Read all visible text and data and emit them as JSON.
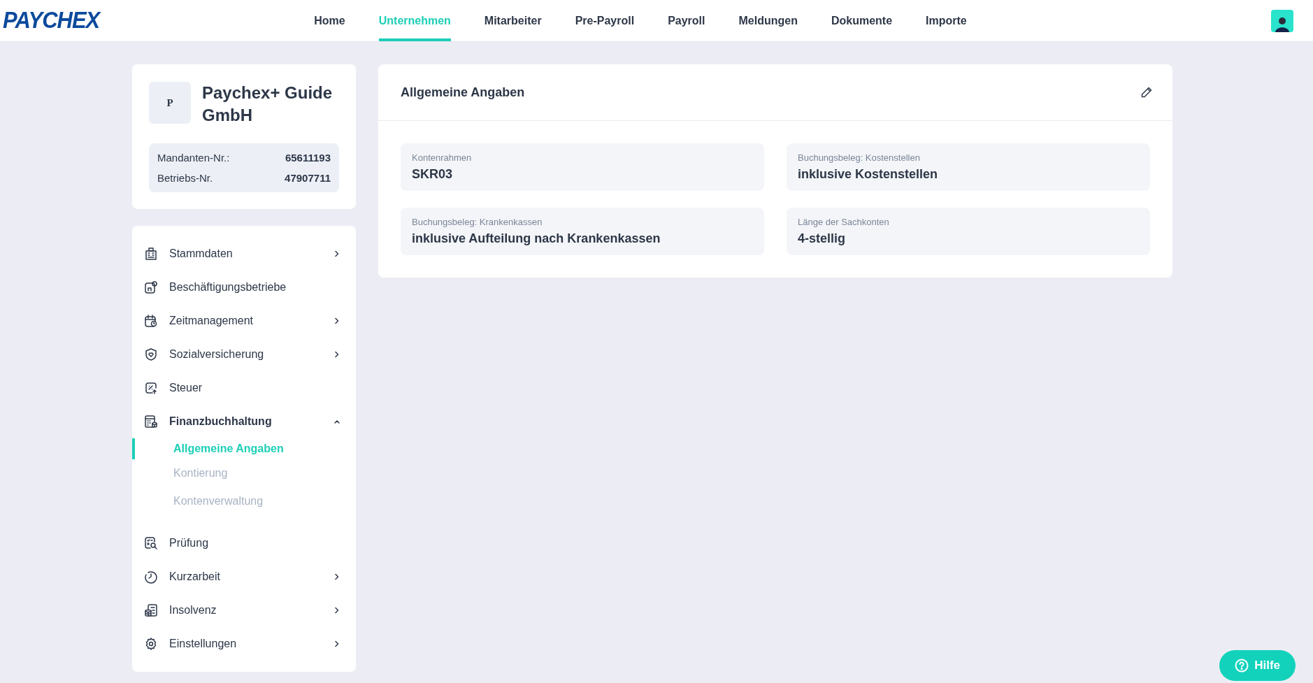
{
  "logo": "PAYCHEX",
  "nav": [
    {
      "label": "Home",
      "selected": false
    },
    {
      "label": "Unternehmen",
      "selected": true
    },
    {
      "label": "Mitarbeiter",
      "selected": false
    },
    {
      "label": "Pre-Payroll",
      "selected": false
    },
    {
      "label": "Payroll",
      "selected": false
    },
    {
      "label": "Meldungen",
      "selected": false
    },
    {
      "label": "Dokumente",
      "selected": false
    },
    {
      "label": "Importe",
      "selected": false
    }
  ],
  "company": {
    "initial": "P",
    "name": "Paychex+ Guide GmbH",
    "facts": [
      {
        "label": "Mandanten-Nr.:",
        "value": "65611193"
      },
      {
        "label": "Betriebs-Nr.",
        "value": "47907711"
      }
    ]
  },
  "menu": [
    {
      "label": "Stammdaten",
      "has_submenu": true,
      "expanded": false
    },
    {
      "label": "Beschäftigungsbetriebe",
      "has_submenu": false,
      "expanded": false
    },
    {
      "label": "Zeitmanagement",
      "has_submenu": true,
      "expanded": false
    },
    {
      "label": "Sozialversicherung",
      "has_submenu": true,
      "expanded": false
    },
    {
      "label": "Steuer",
      "has_submenu": false,
      "expanded": false
    },
    {
      "label": "Finanzbuchhaltung",
      "has_submenu": true,
      "expanded": true,
      "children": [
        {
          "label": "Allgemeine Angaben",
          "selected": true,
          "disabled": false
        },
        {
          "label": "Kontierung",
          "selected": false,
          "disabled": true
        },
        {
          "label": "Kontenverwaltung",
          "selected": false,
          "disabled": true
        }
      ]
    },
    {
      "label": "Prüfung",
      "has_submenu": false,
      "expanded": false
    },
    {
      "label": "Kurzarbeit",
      "has_submenu": true,
      "expanded": false
    },
    {
      "label": "Insolvenz",
      "has_submenu": true,
      "expanded": false
    },
    {
      "label": "Einstellungen",
      "has_submenu": true,
      "expanded": false
    }
  ],
  "panel": {
    "title": "Allgemeine Angaben",
    "fields": [
      {
        "label": "Kontenrahmen",
        "value": "SKR03"
      },
      {
        "label": "Buchungsbeleg: Kostenstellen",
        "value": "inklusive Kostenstellen"
      },
      {
        "label": "Buchungsbeleg: Krankenkassen",
        "value": "inklusive Aufteilung nach Krankenkassen"
      },
      {
        "label": "Länge der Sachkonten",
        "value": "4-stellig"
      }
    ]
  },
  "help_button": "Hilfe"
}
